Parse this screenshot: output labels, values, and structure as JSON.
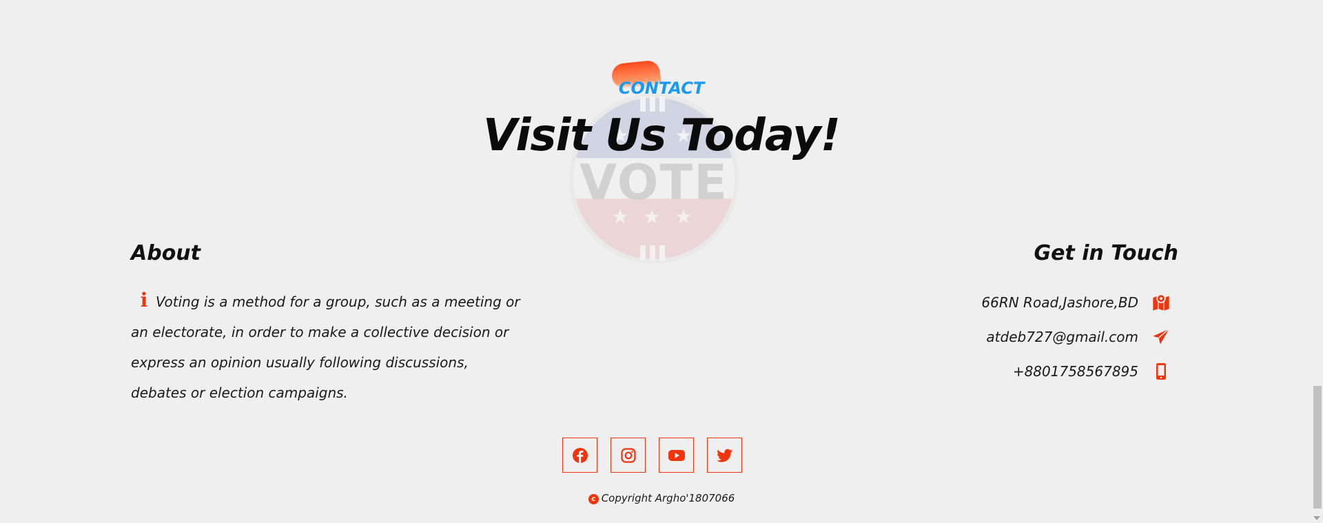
{
  "contact_section": {
    "eyebrow": "CONTACT",
    "title": "Visit Us Today!",
    "badge_word": "VOTE",
    "badge_stars": "★ ★ ★"
  },
  "about": {
    "heading": "About",
    "text": "Voting is a method for a group, such as a meeting or an electorate, in order to make a collective decision or express an opinion usually following discussions, debates or election campaigns.",
    "icon": "info-icon"
  },
  "get_in_touch": {
    "heading": "Get in Touch",
    "items": [
      {
        "text": "66RN Road,Jashore,BD",
        "icon": "map-icon"
      },
      {
        "text": "atdeb727@gmail.com",
        "icon": "send-icon"
      },
      {
        "text": "+8801758567895",
        "icon": "mobile-icon"
      }
    ]
  },
  "socials": [
    {
      "icon": "facebook-icon"
    },
    {
      "icon": "instagram-icon"
    },
    {
      "icon": "youtube-icon"
    },
    {
      "icon": "twitter-icon"
    }
  ],
  "footer": {
    "copyright": "Copyright Argho'1807066",
    "copyright_icon": "c"
  },
  "colors": {
    "accent": "#f0340e",
    "eyebrow": "#1a9bef",
    "background": "#efefef"
  }
}
